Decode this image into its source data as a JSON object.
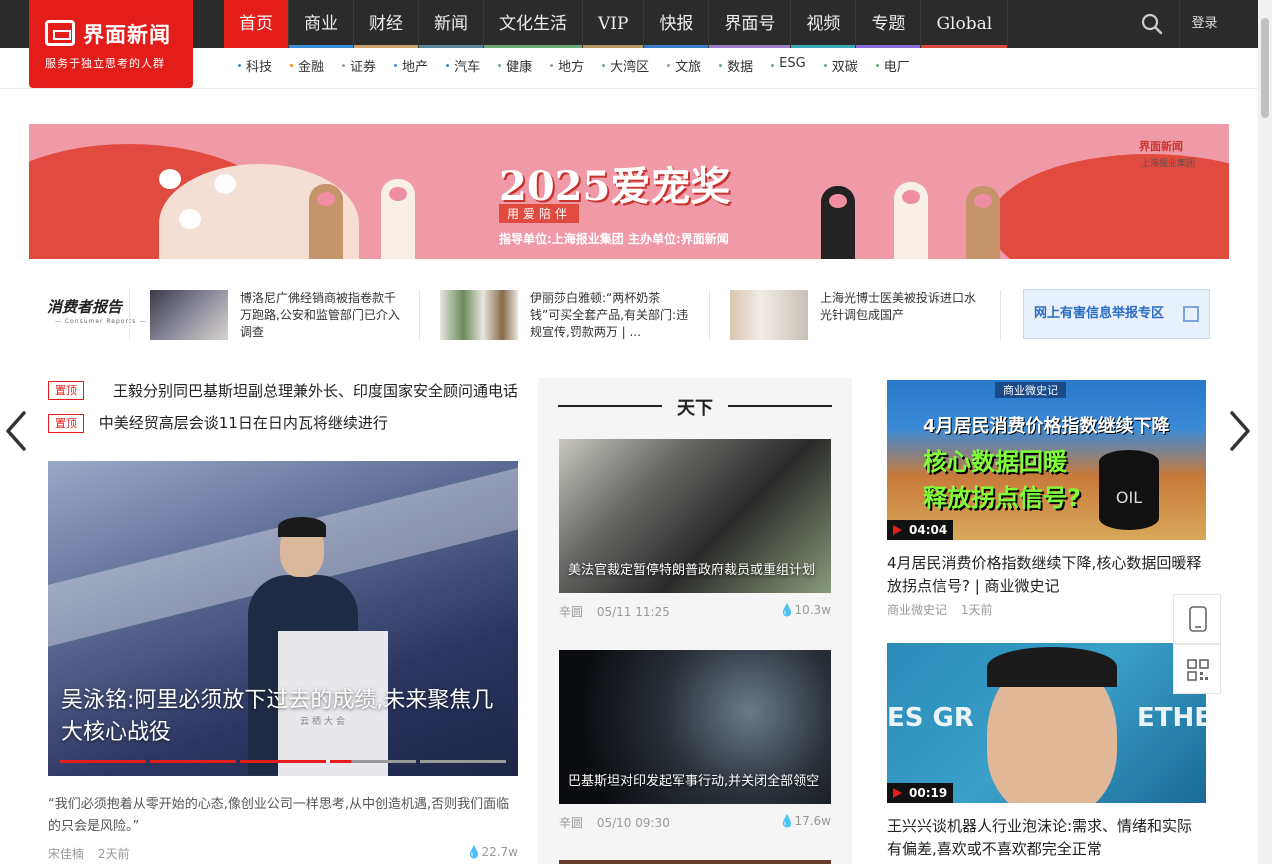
{
  "brand": {
    "name": "界面新闻",
    "slogan": "服务于独立思考的人群"
  },
  "nav": {
    "items": [
      {
        "label": "首页",
        "color": "#e31d1a",
        "active": true
      },
      {
        "label": "商业",
        "color": "#3a8fd9"
      },
      {
        "label": "财经",
        "color": "#c9a56b"
      },
      {
        "label": "新闻",
        "color": "#5a8a9a"
      },
      {
        "label": "文化生活",
        "color": "#6bab7a"
      },
      {
        "label": "VIP",
        "color": "#b59a62"
      },
      {
        "label": "快报",
        "color": "#3a7dc9"
      },
      {
        "label": "界面号",
        "color": "#9a7ac9"
      },
      {
        "label": "视频",
        "color": "#3aa8b9"
      },
      {
        "label": "专题",
        "color": "#8a6ad9"
      },
      {
        "label": "Global",
        "color": "#d94a3a"
      }
    ],
    "login": "登录"
  },
  "subnav": [
    {
      "label": "科技",
      "color": "#3a8fd9"
    },
    {
      "label": "金融",
      "color": "#e3931a"
    },
    {
      "label": "证券",
      "color": "#9a9a9a"
    },
    {
      "label": "地产",
      "color": "#3a8fd9"
    },
    {
      "label": "汽车",
      "color": "#3a8fd9"
    },
    {
      "label": "健康",
      "color": "#6bab7a"
    },
    {
      "label": "地方",
      "color": "#9a9a9a"
    },
    {
      "label": "大湾区",
      "color": "#6bab7a"
    },
    {
      "label": "文旅",
      "color": "#9a9a9a"
    },
    {
      "label": "数据",
      "color": "#6bab7a"
    },
    {
      "label": "ESG",
      "color": "#6bab7a"
    },
    {
      "label": "双碳",
      "color": "#6bab7a"
    },
    {
      "label": "电厂",
      "color": "#6bab7a"
    }
  ],
  "banner": {
    "title": "2025爱宠奖",
    "tag": "用爱陪伴",
    "sub": "指导单位:上海报业集团    主办单位:界面新闻",
    "brand": "界面新闻",
    "brand_sub": "上海报业集团"
  },
  "consumer_report": {
    "logo": "消费者报告",
    "logo_sub": "— Consumer Reports —",
    "items": [
      "博洛尼广佛经销商被指卷款千万跑路,公安和监管部门已介入调查",
      "伊丽莎白雅顿:“两杯奶茶钱”可买全套产品,有关部门:违规宣传,罚款两万 | ...",
      "上海光博士医美被投诉进口水光针调包成国产"
    ],
    "report_box": "网上有害信息举报专区"
  },
  "pinned": {
    "tag": "置顶",
    "items": [
      "王毅分别同巴基斯坦副总理兼外长、印度国家安全顾问通电话",
      "中美经贸高层会谈11日在日内瓦将继续进行"
    ]
  },
  "hero": {
    "title": "吴泳铭:阿里必须放下过去的成绩,未来聚焦几大核心战役",
    "podium_text": "云栖大会",
    "desc": "“我们必须抱着从零开始的心态,像创业公司一样思考,从中创造机遇,否则我们面临的只会是风险。”",
    "author": "宋佳楠",
    "time": "2天前",
    "views": "22.7w"
  },
  "mid": {
    "title": "天下",
    "cards": [
      {
        "title": "美法官裁定暂停特朗普政府裁员或重组计划",
        "author": "辛圆",
        "time": "05/11 11:25",
        "views": "10.3w"
      },
      {
        "title": "巴基斯坦对印发起军事行动,并关闭全部领空",
        "author": "辛圆",
        "time": "05/10 09:30",
        "views": "17.6w"
      }
    ]
  },
  "right": {
    "cards": [
      {
        "duration": "04:04",
        "img_l1": "商业微史记",
        "img_l2": "4月居民消费价格指数继续下降",
        "img_l3": "核心数据回暖",
        "img_l4": "释放拐点信号?",
        "img_oil": "OIL",
        "title": "4月居民消费价格指数继续下降,核心数据回暖释放拐点信号? | 商业微史记",
        "author": "商业微史记",
        "time": "1天前"
      },
      {
        "duration": "00:19",
        "img_l1": "ES GR",
        "img_l2": "ETHE",
        "title": "王兴兴谈机器人行业泡沫论:需求、情绪和实际有偏差,喜欢或不喜欢都完全正常"
      }
    ]
  }
}
